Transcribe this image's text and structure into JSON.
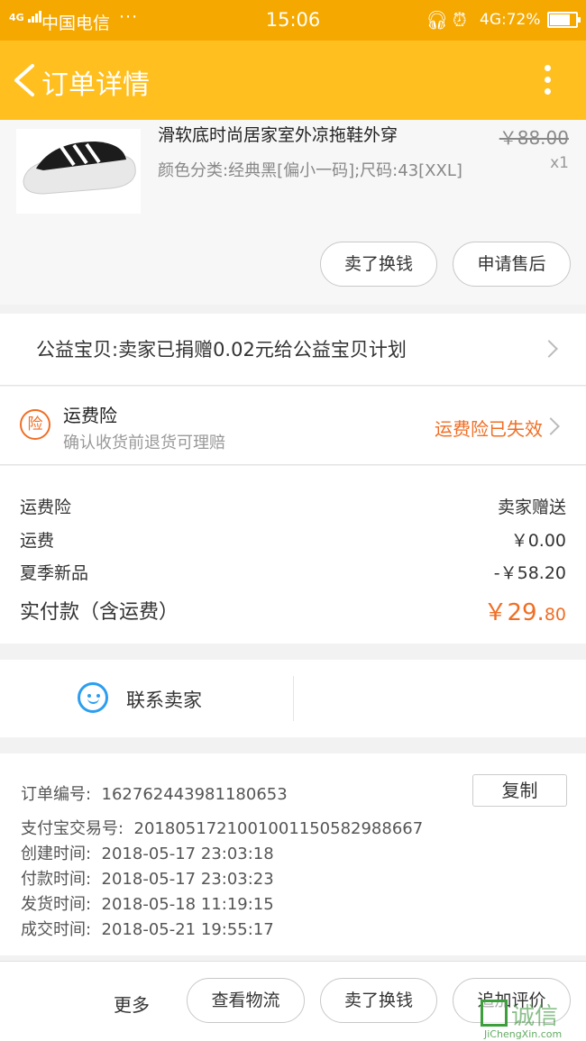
{
  "status_bar": {
    "network_type": "4G",
    "carrier": "中国电信",
    "more_dots": "···",
    "time": "15:06",
    "network": "4G:",
    "battery": "72%"
  },
  "header": {
    "title": "订单详情"
  },
  "product": {
    "name": "滑软底时尚居家室外凉拖鞋外穿",
    "spec": "颜色分类:经典黑[偏小一码];尺码:43[XXL]",
    "original_price": "￥88.00",
    "quantity": "x1",
    "actions": [
      "卖了换钱",
      "申请售后"
    ]
  },
  "charity": {
    "text": "公益宝贝:卖家已捐赠0.02元给公益宝贝计划"
  },
  "shipping_insurance": {
    "badge": "险",
    "name": "运费险",
    "description": "确认收货前退货可理赔",
    "status": "运费险已失效"
  },
  "costs": {
    "rows": [
      {
        "label": "运费险",
        "value": "卖家赠送"
      },
      {
        "label": "运费",
        "value": "￥0.00"
      },
      {
        "label": "夏季新品",
        "value": "-￥58.20"
      }
    ],
    "total_label": "实付款（含运费）",
    "total_int": "￥29.",
    "total_dec": "80"
  },
  "contact": {
    "label": "联系卖家"
  },
  "order_info": {
    "copy_label": "复制",
    "rows": [
      {
        "label": "订单编号:",
        "value": "162762443981180653"
      },
      {
        "label": "支付宝交易号:",
        "value": "2018051721001001150582988667"
      },
      {
        "label": "创建时间:",
        "value": "2018-05-17 23:03:18"
      },
      {
        "label": "付款时间:",
        "value": "2018-05-17 23:03:23"
      },
      {
        "label": "发货时间:",
        "value": "2018-05-18 11:19:15"
      },
      {
        "label": "成交时间:",
        "value": "2018-05-21 19:55:17"
      }
    ]
  },
  "bottom_bar": {
    "more_label": "更多",
    "buttons": [
      "查看物流",
      "卖了换钱",
      "追加评价"
    ]
  },
  "watermark": {
    "text": "诚信",
    "sub": "JiChengXin.com"
  }
}
